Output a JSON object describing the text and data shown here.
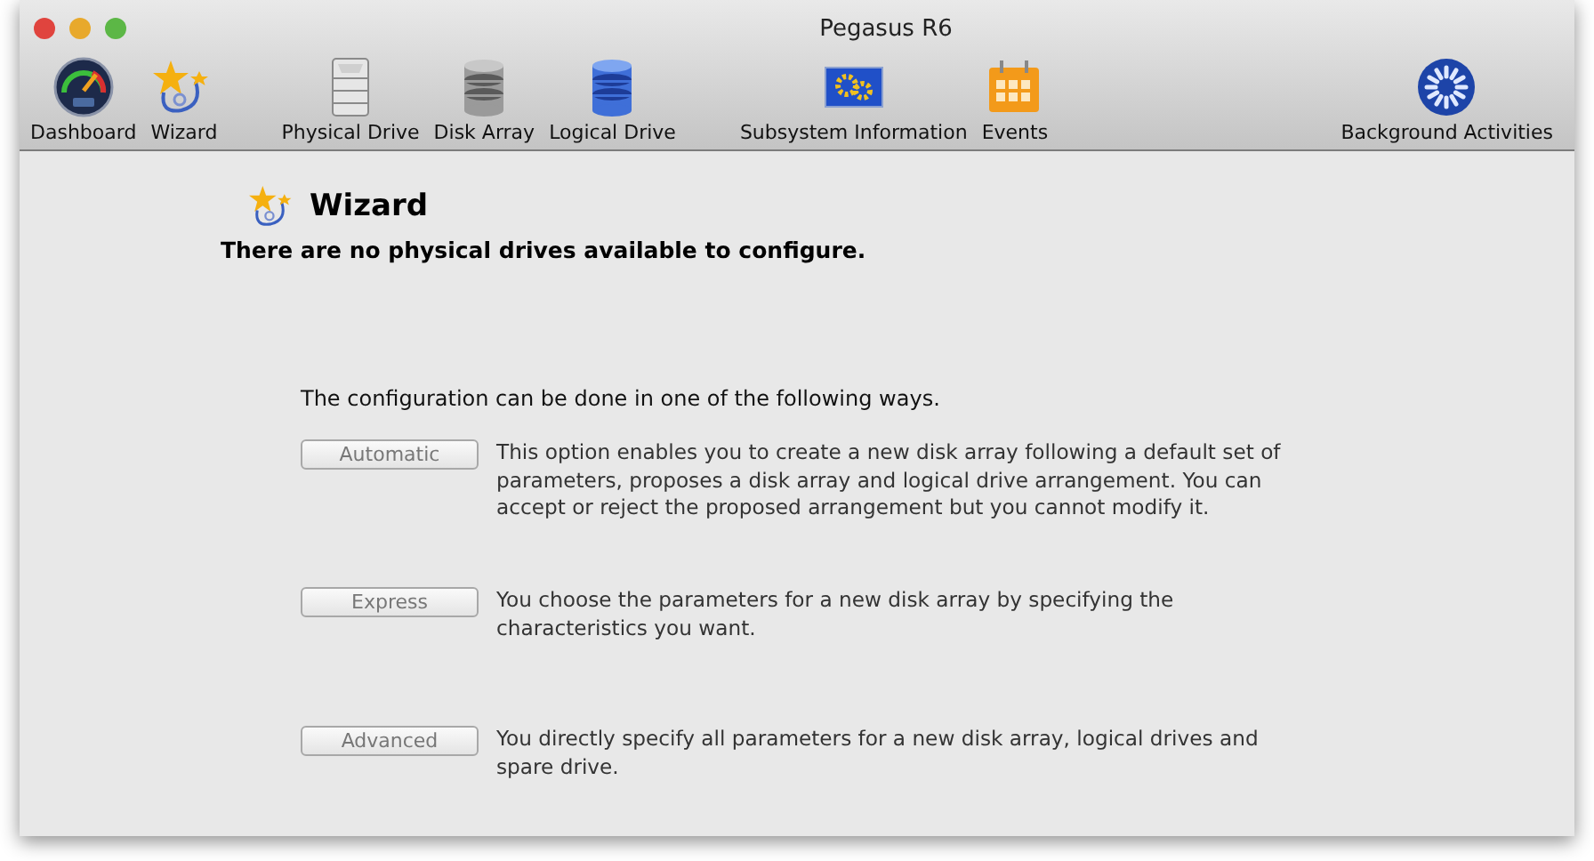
{
  "window": {
    "title": "Pegasus R6"
  },
  "toolbar": [
    [
      {
        "label": "Dashboard",
        "kind": "gauge"
      },
      {
        "label": "Wizard",
        "kind": "wizard"
      }
    ],
    [
      {
        "label": "Physical Drive",
        "kind": "drive"
      },
      {
        "label": "Disk Array",
        "kind": "array"
      },
      {
        "label": "Logical Drive",
        "kind": "logical"
      }
    ],
    [
      {
        "label": "Subsystem Information",
        "kind": "monitor"
      },
      {
        "label": "Events",
        "kind": "calendar"
      }
    ],
    [
      {
        "label": "Background Activities",
        "kind": "spinner"
      }
    ]
  ],
  "heading": "Wizard",
  "notice": "There are no physical drives available to configure.",
  "intro": "The configuration can be done in one of the following ways.",
  "options": [
    {
      "button": "Automatic",
      "disabled": true,
      "description": "This option enables you to create a new disk array following a default set of parameters, proposes a disk array and logical drive arrangement. You can accept or reject the proposed arrangement but you cannot modify it."
    },
    {
      "button": "Express",
      "disabled": true,
      "description": "You choose the parameters for a new disk array by specifying the characteristics you want."
    },
    {
      "button": "Advanced",
      "disabled": true,
      "description": "You directly specify all parameters for a new disk array, logical drives and spare drive."
    }
  ]
}
